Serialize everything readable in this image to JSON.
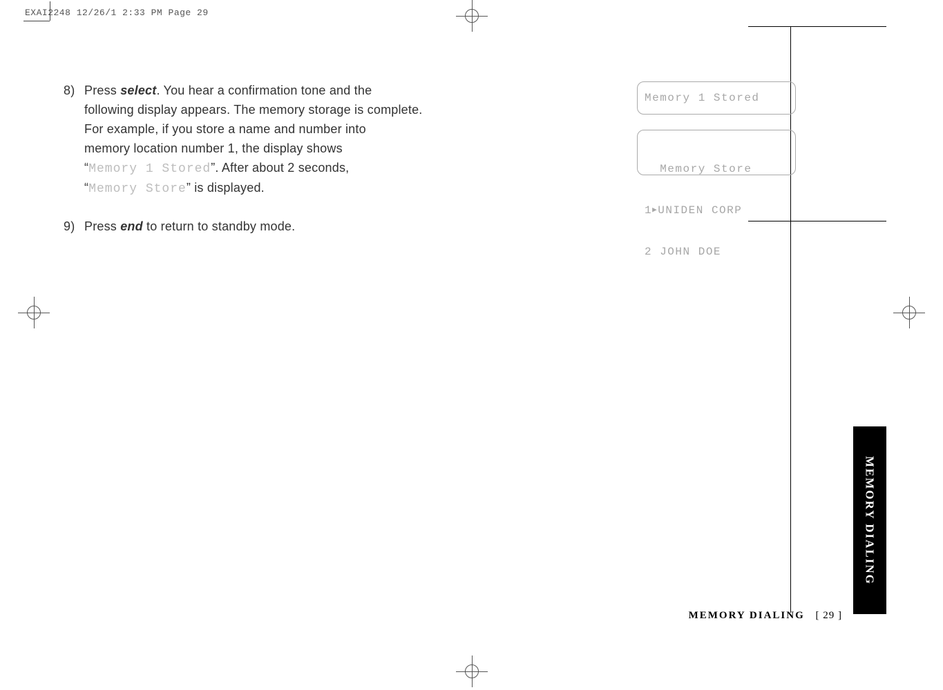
{
  "slug": "EXAI2248  12/26/1 2:33 PM  Page 29",
  "step8": {
    "num": "8)",
    "l1a": "Press ",
    "select": "select",
    "l1b": ". You hear a confirmation tone and the",
    "l2": "following display appears. The memory storage is complete.",
    "l3": "For example, if you store a name and number into",
    "l4": "memory location number 1, the display shows",
    "l5a": "“",
    "lcdA": "Memory 1 Stored",
    "l5b": "”. After about 2 seconds,",
    "l6a": "“",
    "lcdB": "Memory Store",
    "l6b": "” is displayed."
  },
  "step9": {
    "num": "9)",
    "a": "Press ",
    "end": "end",
    "b": " to return to standby mode."
  },
  "lcd1": "Memory 1 Stored",
  "lcd2": {
    "l1": "  Memory Store",
    "l2a": "1",
    "l2b": "UNIDEN CORP",
    "l3": "2 JOHN DOE"
  },
  "tab": "MEMORY DIALING",
  "footer": {
    "title": "MEMORY DIALING",
    "page": "[ 29 ]"
  }
}
